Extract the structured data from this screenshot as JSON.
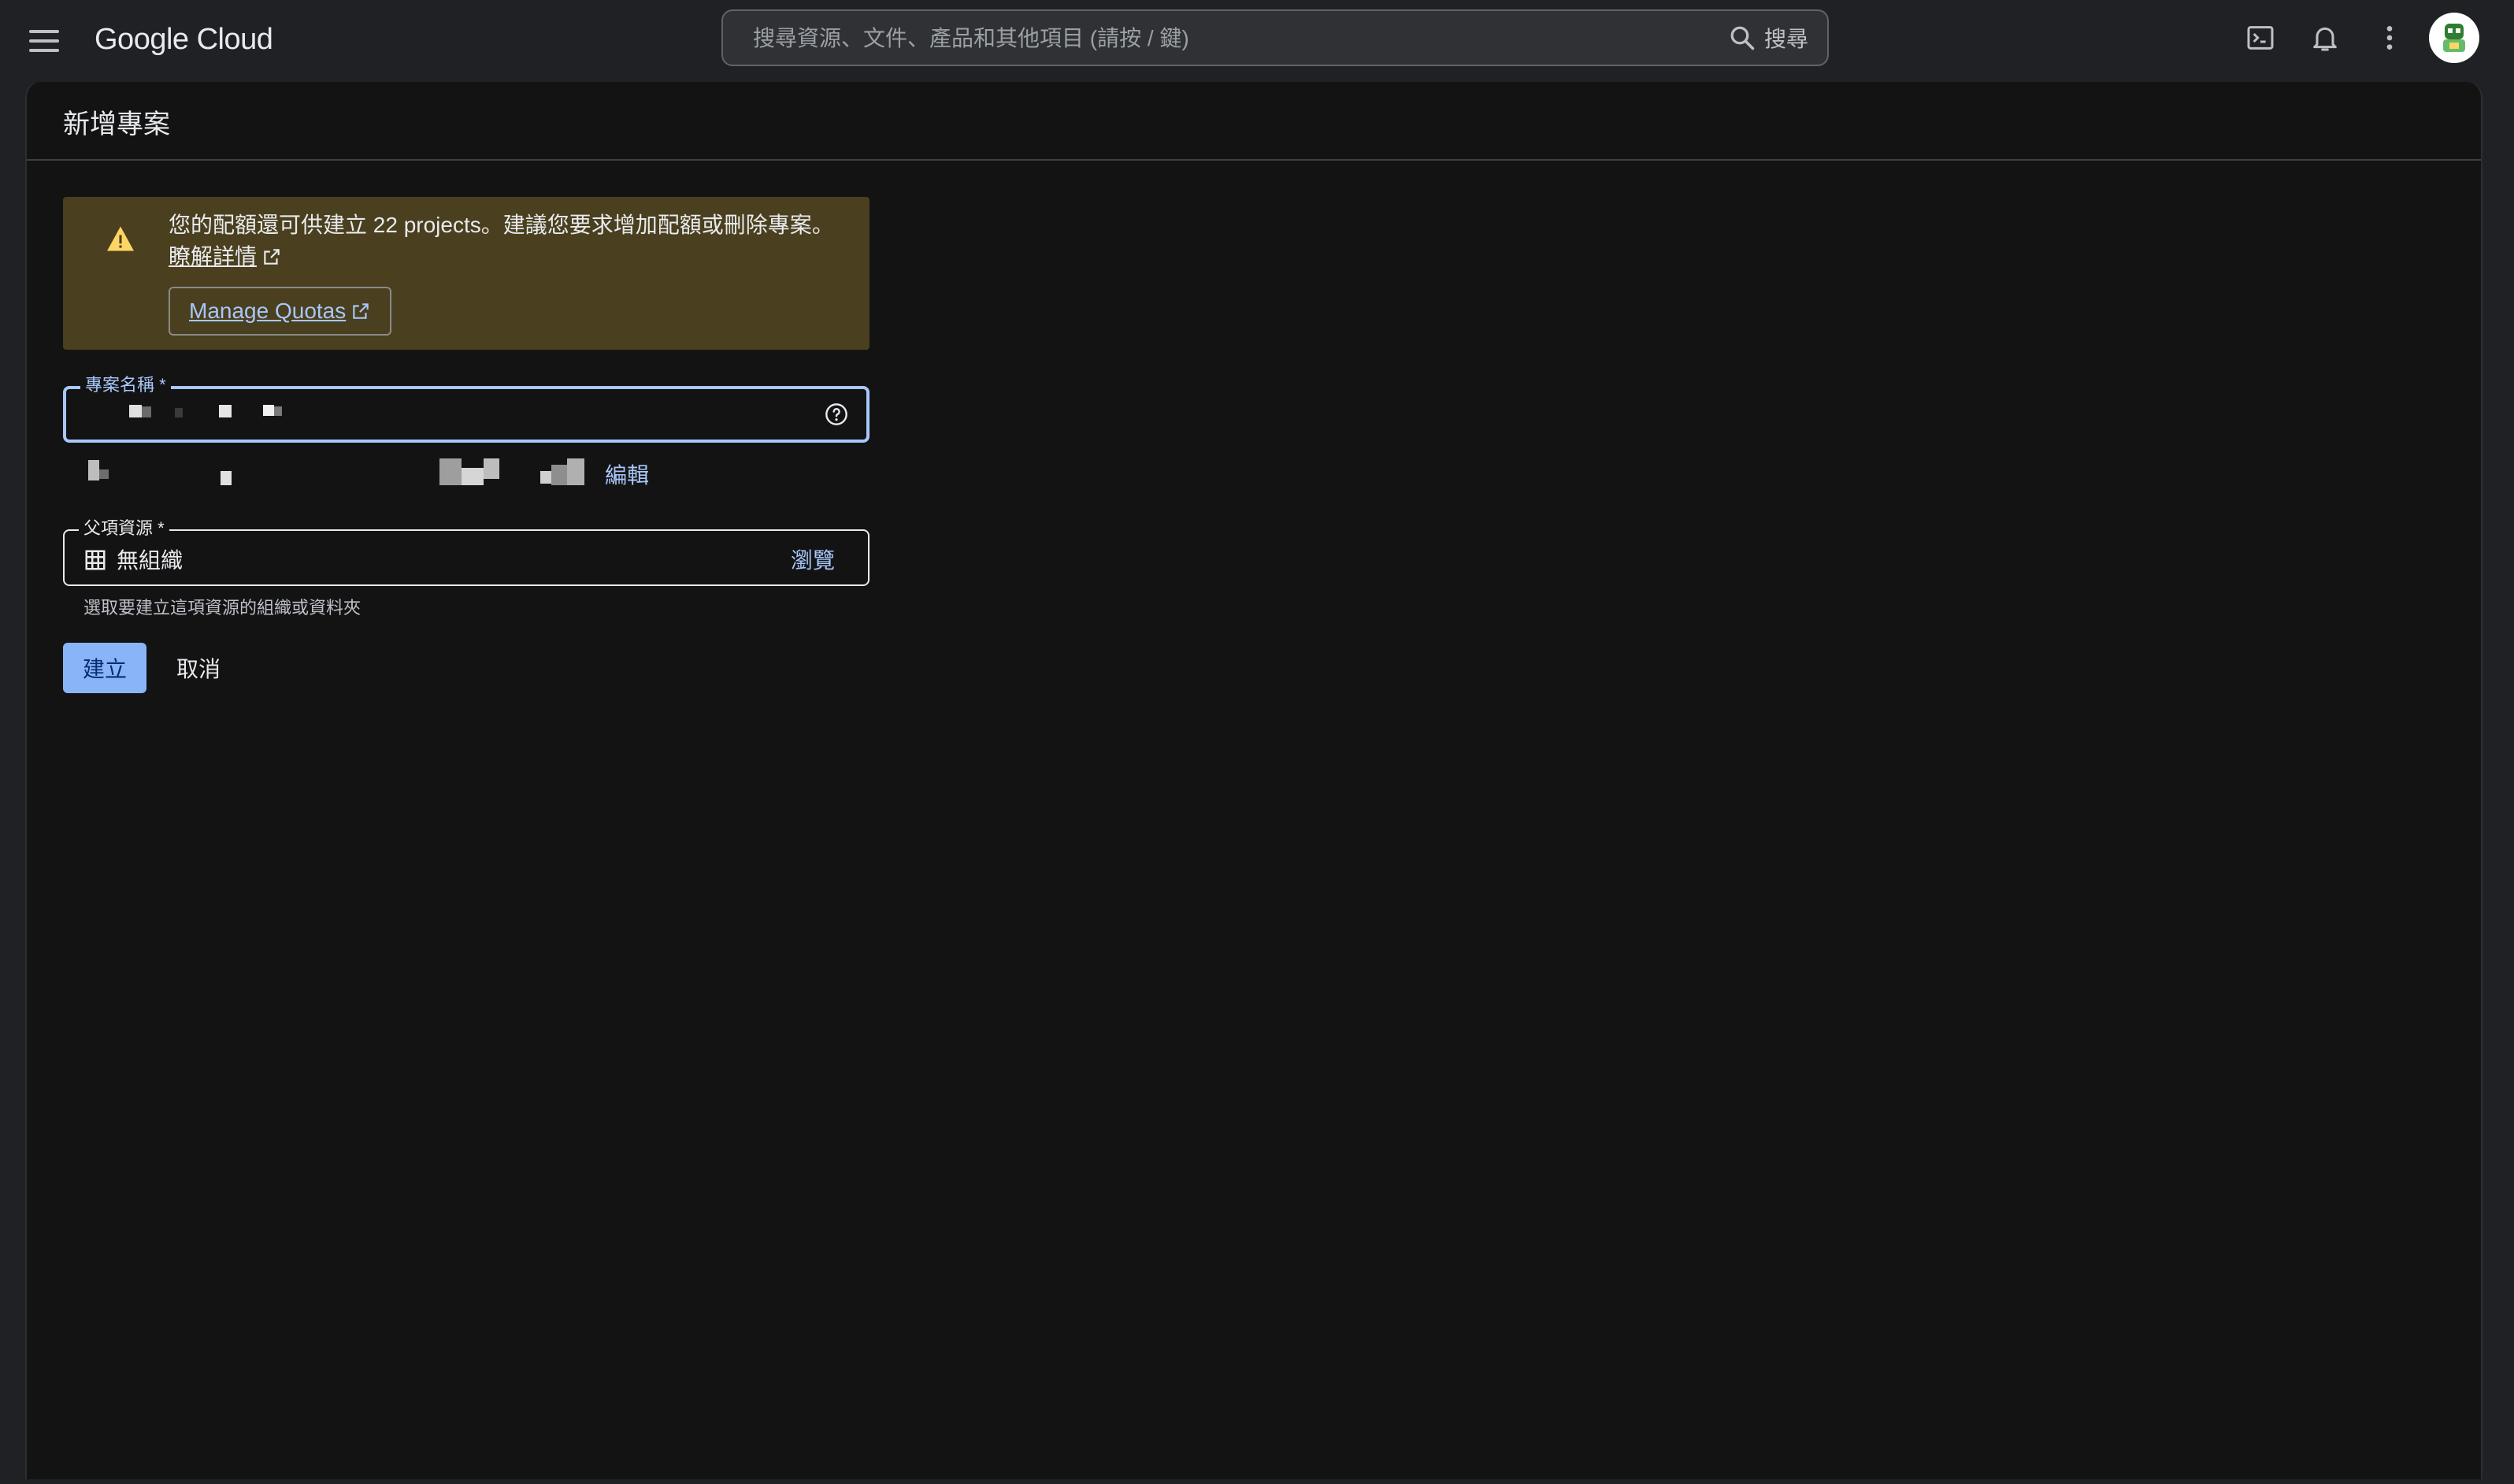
{
  "header": {
    "app_name": "Google Cloud",
    "search_placeholder": "搜尋資源、文件、產品和其他項目 (請按 / 鍵)",
    "search_button_label": "搜尋"
  },
  "page": {
    "title": "新增專案"
  },
  "quota_banner": {
    "message": "您的配額還可供建立 22 projects。建議您要求增加配額或刪除專案。",
    "learn_more_label": "瞭解詳情",
    "manage_quotas_label": "Manage Quotas"
  },
  "project_name_field": {
    "label": "專案名稱 *"
  },
  "project_id": {
    "edit_label": "編輯"
  },
  "parent_resource_field": {
    "label": "父項資源 *",
    "value": "無組織",
    "browse_label": "瀏覽",
    "helper_text": "選取要建立這項資源的組織或資料夾"
  },
  "actions": {
    "create_label": "建立",
    "cancel_label": "取消"
  },
  "colors": {
    "accent": "#a8c7fa",
    "primary_button": "#8ab4f8",
    "warning_banner": "#4a3f1e",
    "warning_icon": "#fdd663"
  }
}
